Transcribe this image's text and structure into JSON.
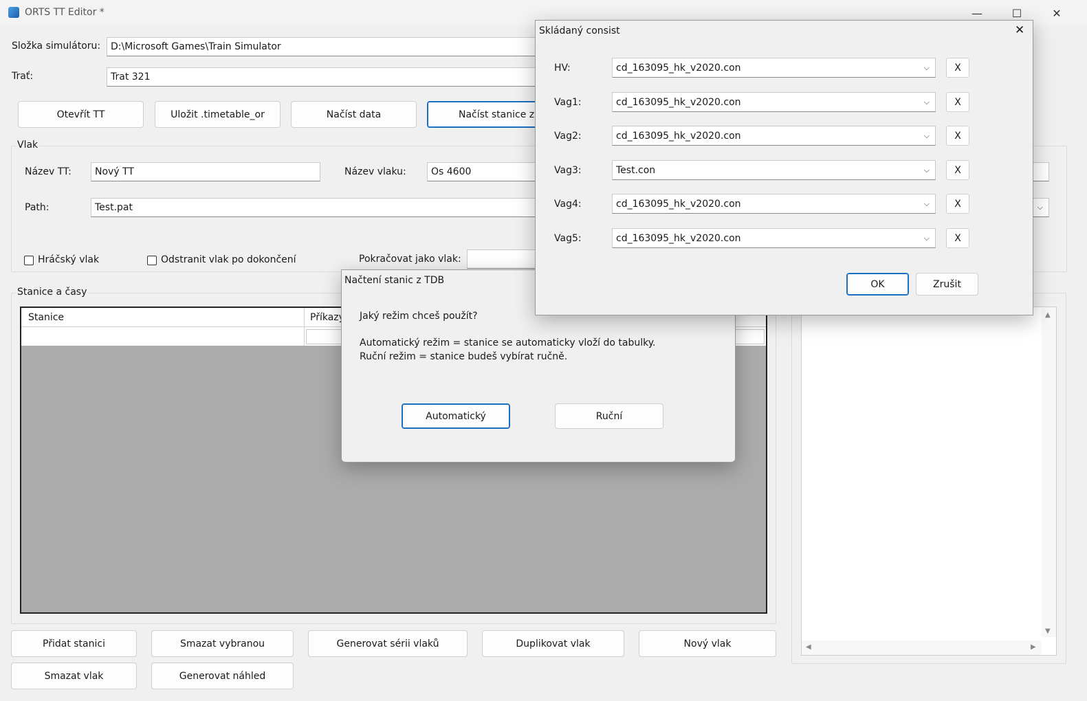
{
  "window": {
    "title": "ORTS TT Editor *",
    "minimize": "—",
    "maximize": "☐",
    "close": "✕"
  },
  "main": {
    "sim_folder_label": "Složka simulátoru:",
    "sim_folder_value": "D:\\Microsoft Games\\Train Simulator",
    "route_label": "Trať:",
    "route_value": "Trat 321",
    "toolbar": {
      "open_tt": "Otevřít TT",
      "save_tt": "Uložit .timetable_or",
      "load_data": "Načíst data",
      "load_stations": "Načíst stanice z T"
    },
    "train_group": {
      "title": "Vlak",
      "tt_name_label": "Název TT:",
      "tt_name_value": "Nový TT",
      "train_name_label": "Název vlaku:",
      "train_name_value": "Os 4600",
      "path_label": "Path:",
      "path_value": "Test.pat",
      "player_train": "Hráčský vlak",
      "remove_after": "Odstranit vlak po dokončení",
      "continue_as": "Pokračovat jako vlak:"
    },
    "stations_group": {
      "title": "Stanice a časy",
      "col_station": "Stanice",
      "col_commands": "Příkazy"
    },
    "bottom_buttons": {
      "add_station": "Přidat stanici",
      "delete_selected": "Smazat vybranou",
      "generate_series": "Generovat sérii vlaků",
      "duplicate_train": "Duplikovat vlak",
      "new_train": "Nový vlak",
      "delete_train": "Smazat vlak",
      "generate_preview": "Generovat náhled"
    }
  },
  "consist_dialog": {
    "title": "Skládaný consist",
    "close": "✕",
    "rows": [
      {
        "label": "HV:",
        "value": "cd_163095_hk_v2020.con"
      },
      {
        "label": "Vag1:",
        "value": "cd_163095_hk_v2020.con"
      },
      {
        "label": "Vag2:",
        "value": "cd_163095_hk_v2020.con"
      },
      {
        "label": "Vag3:",
        "value": "Test.con"
      },
      {
        "label": "Vag4:",
        "value": "cd_163095_hk_v2020.con"
      },
      {
        "label": "Vag5:",
        "value": "cd_163095_hk_v2020.con"
      }
    ],
    "remove_label": "X",
    "ok": "OK",
    "cancel": "Zrušit"
  },
  "tdb_dialog": {
    "title": "Načtení stanic z TDB",
    "question": "Jaký režim chceš použít?",
    "auto_desc": "Automatický režim = stanice se automaticky vloží do tabulky.",
    "manual_desc": "Ruční režim = stanice budeš vybírat ručně.",
    "auto_button": "Automatický",
    "manual_button": "Ruční"
  }
}
